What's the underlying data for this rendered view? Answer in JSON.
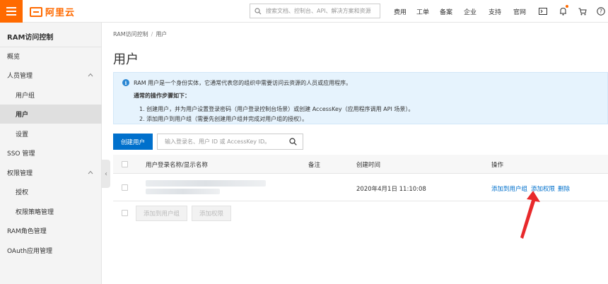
{
  "topbar": {
    "logo_text": "阿里云",
    "search_placeholder": "搜索文档、控制台、API、解决方案和资源",
    "nav": [
      "费用",
      "工单",
      "备案",
      "企业",
      "支持",
      "官网"
    ],
    "accent_color": "#ff6a00"
  },
  "sidebar": {
    "title": "RAM访问控制",
    "items": [
      {
        "label": "概览"
      },
      {
        "label": "人员管理"
      },
      {
        "label": "用户组"
      },
      {
        "label": "用户"
      },
      {
        "label": "设置"
      },
      {
        "label": "SSO 管理"
      },
      {
        "label": "权限管理"
      },
      {
        "label": "授权"
      },
      {
        "label": "权限策略管理"
      },
      {
        "label": "RAM角色管理"
      },
      {
        "label": "OAuth应用管理"
      }
    ],
    "active_item": "用户"
  },
  "breadcrumb": {
    "root": "RAM访问控制",
    "separator": "/",
    "current": "用户"
  },
  "page_title": "用户",
  "info": {
    "line1": "RAM 用户是一个身份实体，它通常代表您的组织中需要访问云资源的人员或应用程序。",
    "heading": "通常的操作步骤如下：",
    "step1": "1. 创建用户，并为用户设置登录密码（用户登录控制台场景）或创建 AccessKey（应用程序调用 API 场景）。",
    "step2": "2. 添加用户到用户组（需要先创建用户组并完成对用户组的授权）。"
  },
  "toolbar": {
    "create_label": "创建用户",
    "search_placeholder": "输入登录名、用户 ID 或 AccessKey ID。"
  },
  "table": {
    "headers": {
      "name": "用户登录名称/显示名称",
      "note": "备注",
      "created": "创建时间",
      "actions": "操作"
    },
    "rows": [
      {
        "created": "2020年4月1日 11:10:08",
        "actions": [
          "添加到用户组",
          "添加权限",
          "删除"
        ]
      }
    ]
  },
  "bulk": {
    "add_to_group": "添加到用户组",
    "add_permission": "添加权限"
  },
  "link_color": "#0070cc",
  "annotation_color": "#e8292b"
}
